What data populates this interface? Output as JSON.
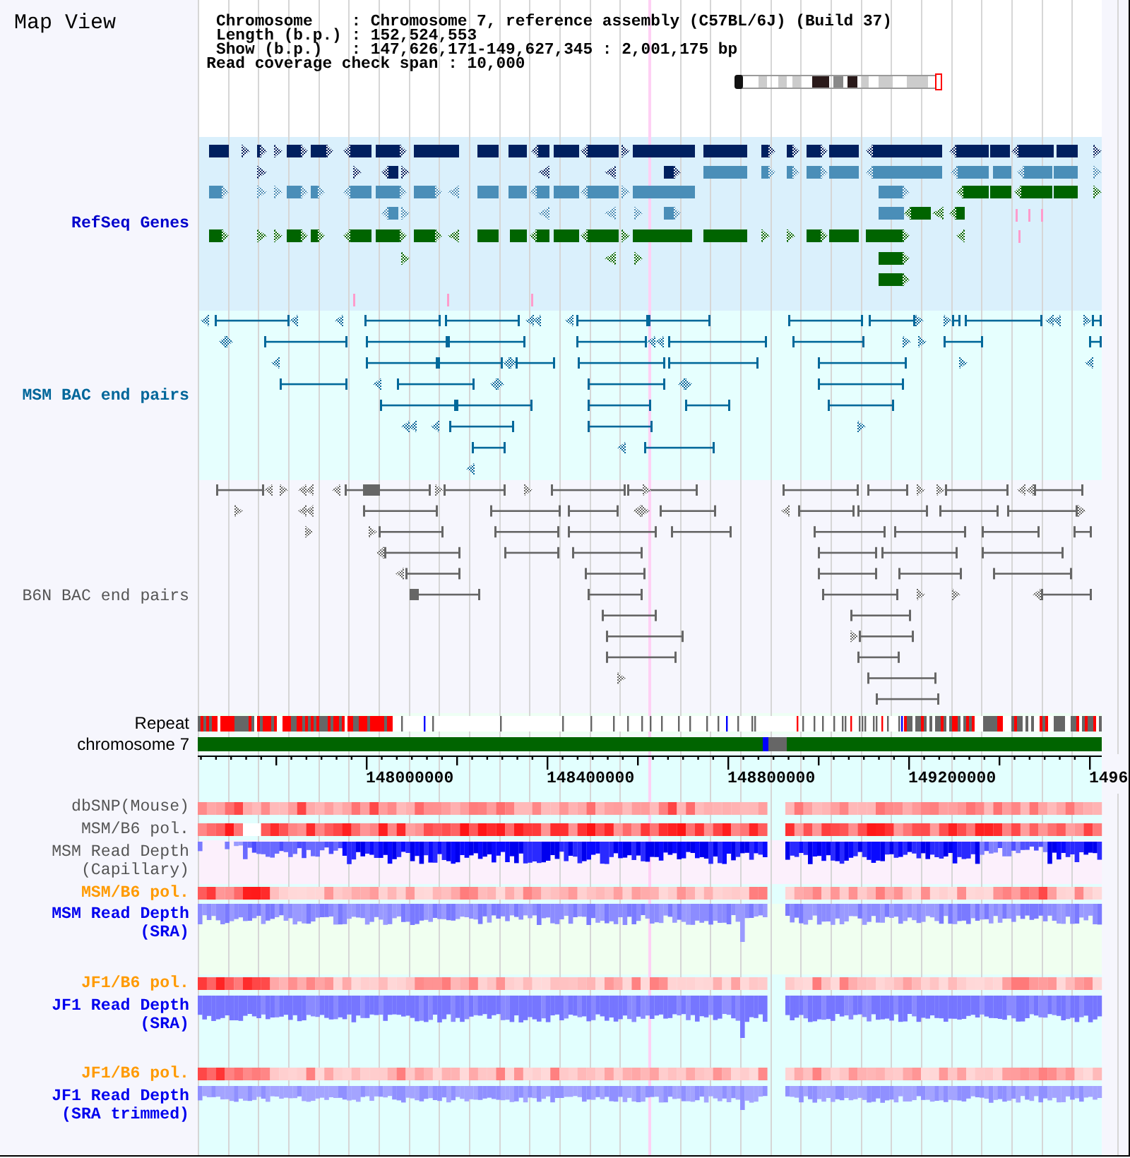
{
  "map_view": {
    "title": "Map View"
  },
  "header": {
    "fields": [
      {
        "label": "Chromosome",
        "separator": ":",
        "value": "Chromosome 7, reference assembly (C57BL/6J) (Build 37)"
      },
      {
        "label": "Length (b.p.)",
        "separator": ":",
        "value": "152,524,553"
      },
      {
        "label": "Show (b.p.)",
        "separator": ":",
        "value": "147,626,171-149,627,345 : 2,001,175 bp"
      },
      {
        "label": "Read coverage check span",
        "separator": ":",
        "value": "10,000"
      }
    ]
  },
  "feature_tracks": [
    {
      "label": "RefSeq Genes",
      "kind": "genes"
    },
    {
      "label": "MSM BAC end pairs",
      "kind": "bacmsm"
    },
    {
      "label": "B6N BAC end pairs",
      "kind": "bacb6n"
    }
  ],
  "repeat_track": {
    "label": "Repeat"
  },
  "chromosome_track": {
    "label": "chromosome 7"
  },
  "axis": {
    "labels": [
      "148000000",
      "148400000",
      "148800000",
      "149200000",
      "1496"
    ]
  },
  "data_tracks": [
    {
      "label": "dbSNP(Mouse)",
      "kind": "snp"
    },
    {
      "label": "MSM/B6 pol.",
      "kind": "pol"
    },
    {
      "label": "MSM Read Depth (Capillary)",
      "kind": "capillary"
    },
    {
      "label": "MSM/B6 pol.",
      "kind": "srapol"
    },
    {
      "label": "MSM Read Depth (SRA)",
      "kind": "msmsra"
    },
    {
      "label": "JF1/B6 pol.",
      "kind": "srapol"
    },
    {
      "label": "JF1 Read Depth (SRA)",
      "kind": "jf1sra"
    },
    {
      "label": "JF1/B6 pol.",
      "kind": "srapol"
    },
    {
      "label": "JF1 Read Depth (SRA trimmed)",
      "kind": "trimmed"
    }
  ]
}
